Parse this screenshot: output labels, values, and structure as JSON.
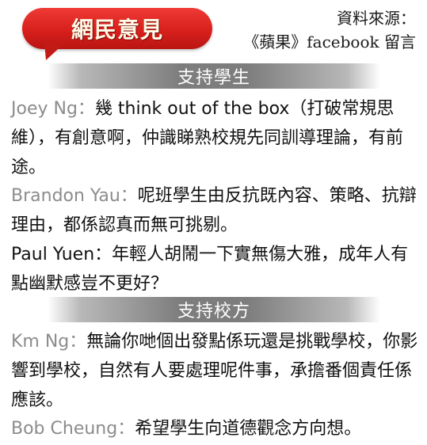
{
  "header": {
    "title": "網民意見",
    "source_line1": "資料來源：",
    "source_line2": "《蘋果》facebook 留言"
  },
  "sections": [
    {
      "heading": "支持學生",
      "comments": [
        {
          "name": "Joey Ng",
          "sep": "：",
          "text": "幾 think out of the box（打破常規思維），有創意啊，仲識睇熟校規先同訓導理論，有前途。"
        },
        {
          "name": "Brandon Yau",
          "sep": "：",
          "text": "呢班學生由反抗既內容、策略、抗辯理由，都係認真而無可挑剔。"
        },
        {
          "name": "Paul Yuen",
          "sep": "：",
          "text": "年輕人胡鬧一下實無傷大雅，成年人有點幽默感豈不更好？"
        }
      ]
    },
    {
      "heading": "支持校方",
      "comments": [
        {
          "name": "Km Ng",
          "sep": "：",
          "text": "無論你哋個出發點係玩還是挑戰學校，你影響到學校，自然有人要處理呢件事，承擔番個責任係應該。"
        },
        {
          "name": "Bob Cheung",
          "sep": "：",
          "text": "希望學生向道德觀念方向想。"
        }
      ]
    }
  ]
}
